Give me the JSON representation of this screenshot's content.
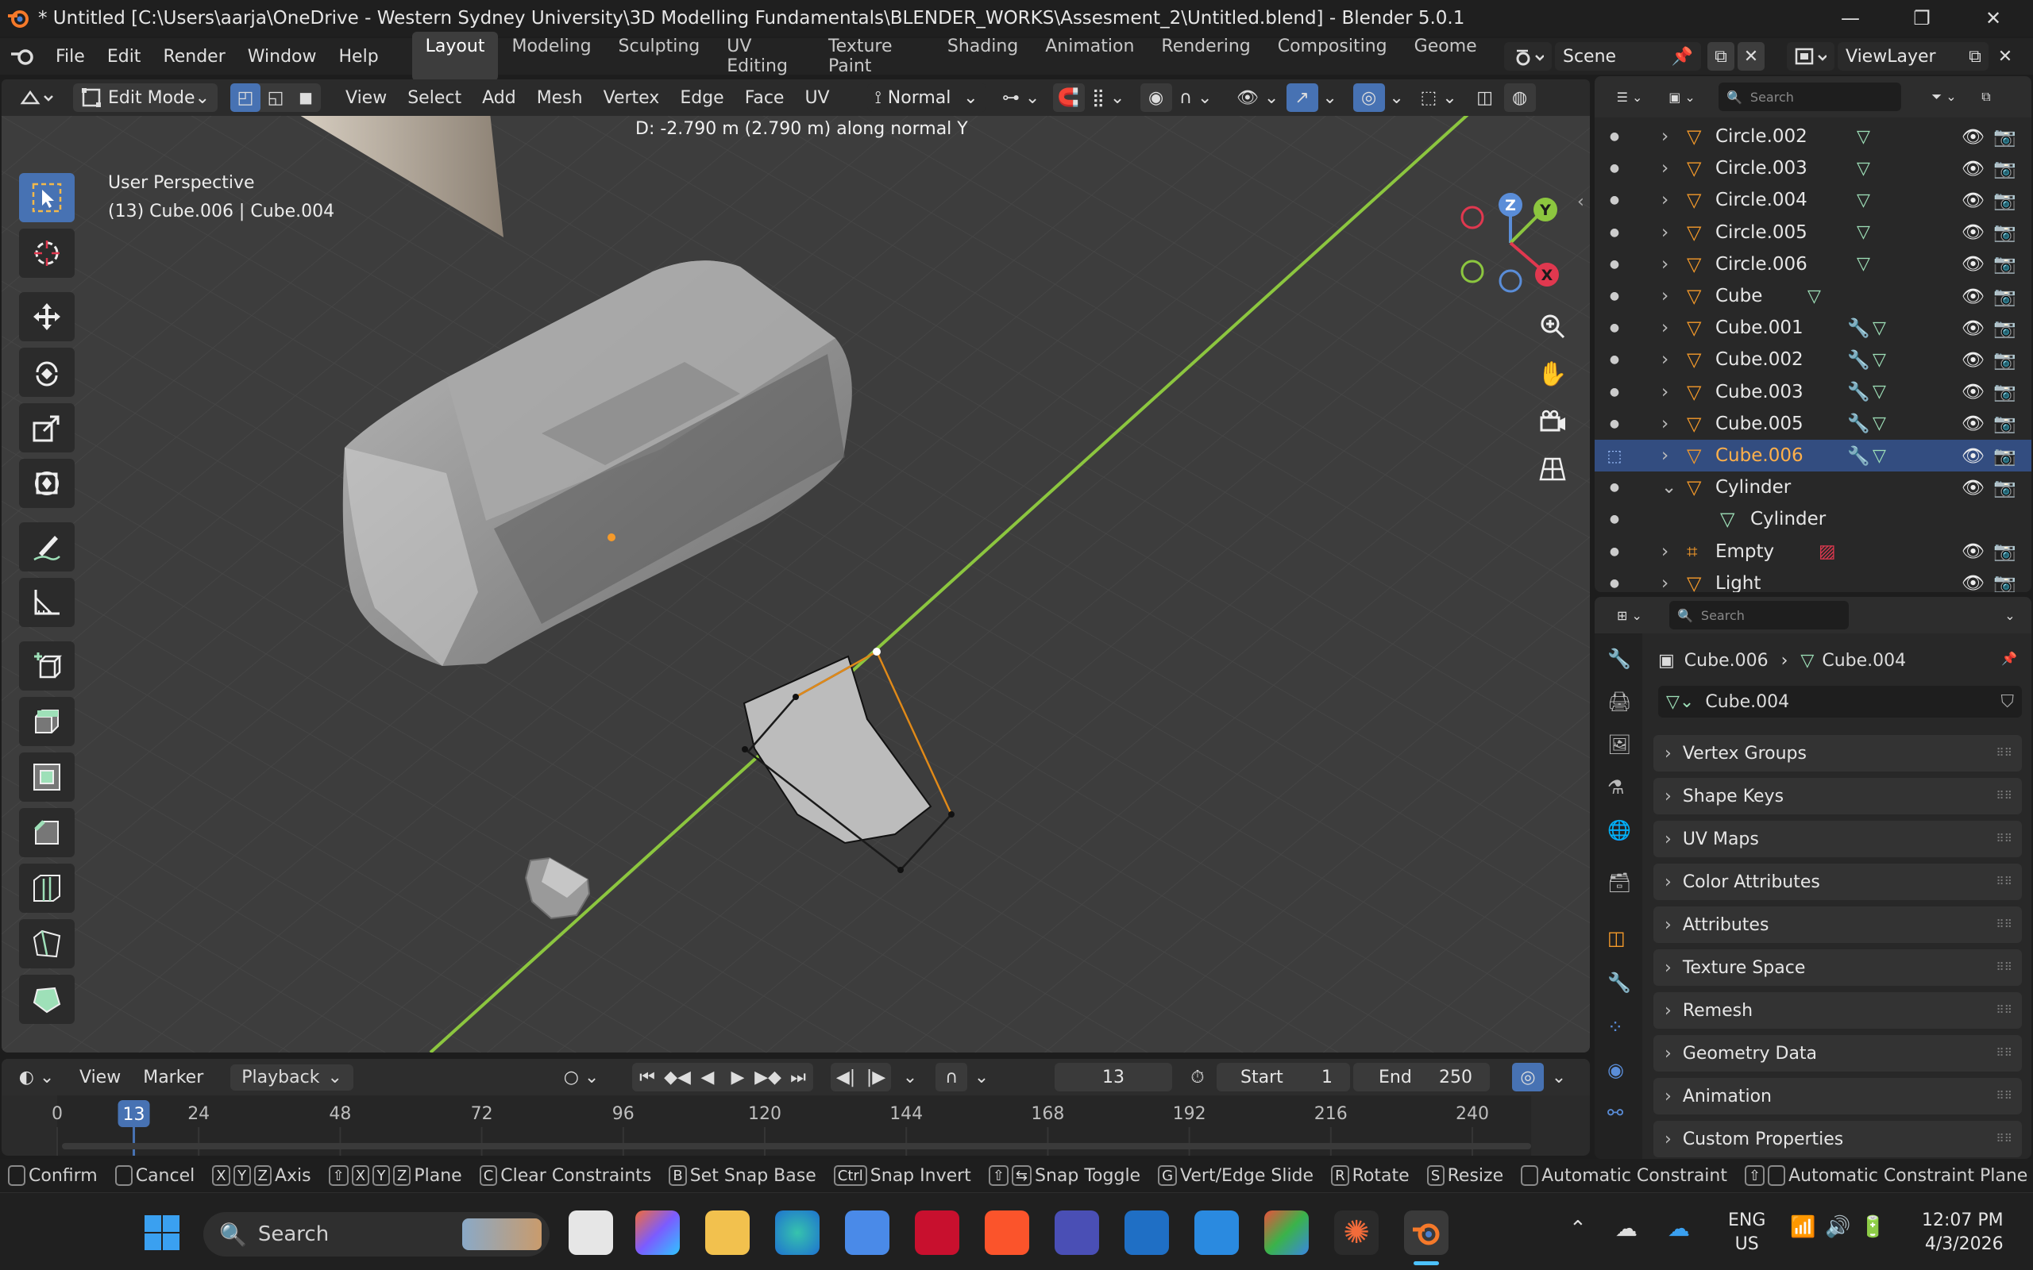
{
  "window": {
    "title": "* Untitled [C:\\Users\\aarja\\OneDrive - Western Sydney University\\3D Modelling Fundamentals\\BLENDER_WORKS\\Assesment_2\\Untitled.blend] - Blender 5.0.1",
    "minimize": "—",
    "restore": "❐",
    "close": "✕"
  },
  "menu": [
    "File",
    "Edit",
    "Render",
    "Window",
    "Help"
  ],
  "workspaces": [
    "Layout",
    "Modeling",
    "Sculpting",
    "UV Editing",
    "Texture Paint",
    "Shading",
    "Animation",
    "Rendering",
    "Compositing",
    "Geome"
  ],
  "scene": {
    "name": "Scene",
    "view_layer": "ViewLayer"
  },
  "viewport_header": {
    "mode": "Edit Mode",
    "menus": [
      "View",
      "Select",
      "Add",
      "Mesh",
      "Vertex",
      "Edge",
      "Face",
      "UV"
    ],
    "orientation": "Normal"
  },
  "viewport": {
    "operator_info": "D: -2.790 m (2.790 m) along normal Y",
    "perspective": "User Perspective",
    "object_info": "(13) Cube.006 | Cube.004",
    "gizmo_axes": [
      "Z",
      "Y",
      "X"
    ]
  },
  "outliner": {
    "search_placeholder": "Search",
    "rows": [
      {
        "name": "Circle.002",
        "modifier": false,
        "selected": false
      },
      {
        "name": "Circle.003",
        "modifier": false,
        "selected": false
      },
      {
        "name": "Circle.004",
        "modifier": false,
        "selected": false
      },
      {
        "name": "Circle.005",
        "modifier": false,
        "selected": false
      },
      {
        "name": "Circle.006",
        "modifier": false,
        "selected": false
      },
      {
        "name": "Cube",
        "modifier": false,
        "selected": false
      },
      {
        "name": "Cube.001",
        "modifier": true,
        "selected": false
      },
      {
        "name": "Cube.002",
        "modifier": true,
        "selected": false
      },
      {
        "name": "Cube.003",
        "modifier": true,
        "selected": false
      },
      {
        "name": "Cube.005",
        "modifier": true,
        "selected": false
      },
      {
        "name": "Cube.006",
        "modifier": true,
        "selected": true
      },
      {
        "name": "Cylinder",
        "modifier": false,
        "selected": false
      },
      {
        "name": "Cylinder",
        "modifier": false,
        "selected": false
      },
      {
        "name": "Empty",
        "modifier": false,
        "selected": false
      },
      {
        "name": "Light",
        "modifier": false,
        "selected": false
      }
    ]
  },
  "properties": {
    "search_placeholder": "Search",
    "breadcrumb_object": "Cube.006",
    "breadcrumb_mesh": "Cube.004",
    "mesh_name": "Cube.004",
    "panels": [
      "Vertex Groups",
      "Shape Keys",
      "UV Maps",
      "Color Attributes",
      "Attributes",
      "Texture Space",
      "Remesh",
      "Geometry Data",
      "Animation",
      "Custom Properties"
    ]
  },
  "timeline": {
    "menus": [
      "View",
      "Marker",
      "Playback"
    ],
    "current_frame": "13",
    "start_label": "Start",
    "start": "1",
    "end_label": "End",
    "end": "250",
    "ticks": [
      "0",
      "24",
      "48",
      "72",
      "96",
      "120",
      "144",
      "168",
      "192",
      "216",
      "240"
    ]
  },
  "statusbar": [
    {
      "keys": [
        ""
      ],
      "label": "Confirm"
    },
    {
      "keys": [
        ""
      ],
      "label": "Cancel"
    },
    {
      "keys": [
        "X",
        "Y",
        "Z"
      ],
      "label": "Axis"
    },
    {
      "keys": [
        "⇧",
        "X",
        "Y",
        "Z"
      ],
      "label": "Plane"
    },
    {
      "keys": [
        "C"
      ],
      "label": "Clear Constraints"
    },
    {
      "keys": [
        "B"
      ],
      "label": "Set Snap Base"
    },
    {
      "keys": [
        "Ctrl"
      ],
      "label": "Snap Invert"
    },
    {
      "keys": [
        "⇧",
        "⇆"
      ],
      "label": "Snap Toggle"
    },
    {
      "keys": [
        "G"
      ],
      "label": "Vert/Edge Slide"
    },
    {
      "keys": [
        "R"
      ],
      "label": "Rotate"
    },
    {
      "keys": [
        "S"
      ],
      "label": "Resize"
    },
    {
      "keys": [
        ""
      ],
      "label": "Automatic Constraint"
    },
    {
      "keys": [
        "⇧",
        ""
      ],
      "label": "Automatic Constraint Plane"
    }
  ],
  "taskbar": {
    "search_placeholder": "Search",
    "language": "ENG",
    "region": "US",
    "time": "12:07 PM",
    "date": "4/3/2026"
  }
}
